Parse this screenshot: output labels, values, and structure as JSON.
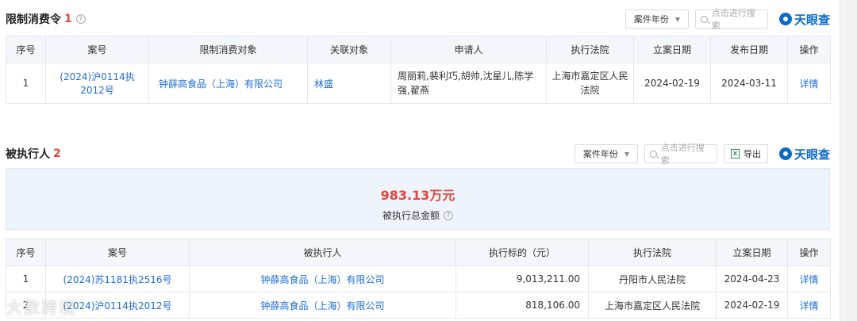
{
  "restrict": {
    "title": "限制消费令",
    "count": "1",
    "help": "?",
    "filter_label": "案件年份",
    "search_placeholder": "点击进行搜索",
    "brand": "天眼查",
    "columns": [
      "序号",
      "案号",
      "限制消费对象",
      "关联对象",
      "申请人",
      "执行法院",
      "立案日期",
      "发布日期",
      "操作"
    ],
    "rows": [
      {
        "index": "1",
        "case_no": "(2024)沪0114执2012号",
        "target": "钟薛高食品（上海）有限公司",
        "related": "林盛",
        "applicant": "周丽莉,裴利巧,胡帅,沈星儿,陈学强,翟燕",
        "court": "上海市嘉定区人民法院",
        "filed": "2024-02-19",
        "published": "2024-03-11",
        "action": "详情"
      }
    ]
  },
  "executed": {
    "title": "被执行人",
    "count": "2",
    "filter_label": "案件年份",
    "search_placeholder": "点击进行搜索",
    "export_label": "导出",
    "brand": "天眼查",
    "total_amount": "983.13万元",
    "total_label": "被执行总金额",
    "help": "?",
    "columns": [
      "序号",
      "案号",
      "被执行人",
      "执行标的（元）",
      "执行法院",
      "立案日期",
      "操作"
    ],
    "rows": [
      {
        "index": "1",
        "case_no": "(2024)苏1181执2516号",
        "party": "钟薛高食品（上海）有限公司",
        "amount": "9,013,211.00",
        "court": "丹阳市人民法院",
        "filed": "2024-04-23",
        "action": "详情"
      },
      {
        "index": "2",
        "case_no": "(2024)沪0114执2012号",
        "party": "钟薛高食品（上海）有限公司",
        "amount": "818,106.00",
        "court": "上海市嘉定区人民法院",
        "filed": "2024-02-19",
        "action": "详情"
      }
    ]
  },
  "watermark": "大数跨境"
}
